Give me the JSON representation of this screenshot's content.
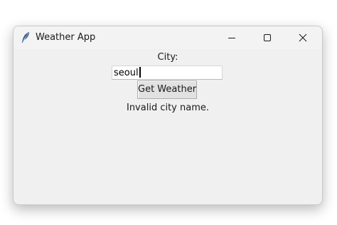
{
  "window": {
    "title": "Weather App",
    "icon": "feather-icon"
  },
  "titlebar_controls": {
    "minimize_icon": "minimize-icon",
    "maximize_icon": "maximize-icon",
    "close_icon": "close-icon"
  },
  "form": {
    "city_label": "City:",
    "city_value": "seoul",
    "button_label": "Get Weather",
    "result": "Invalid city name."
  }
}
